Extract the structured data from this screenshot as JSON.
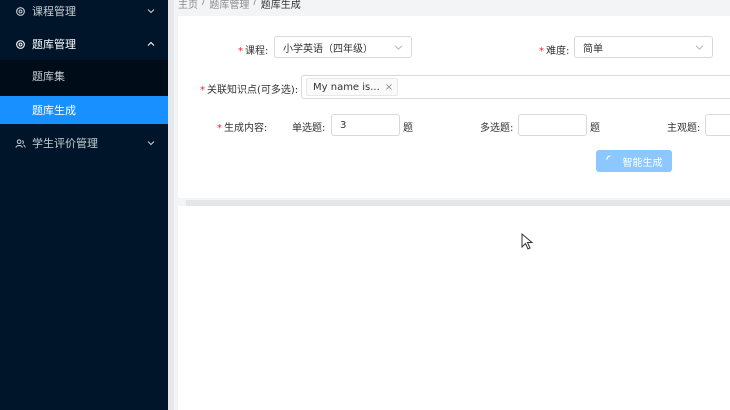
{
  "sidebar": {
    "items": [
      {
        "label": "课程管理",
        "icon": "gear-icon"
      },
      {
        "label": "题库管理",
        "icon": "gear-icon"
      },
      {
        "label": "学生评价管理",
        "icon": "people-icon"
      }
    ],
    "subitems": [
      {
        "label": "题库集"
      },
      {
        "label": "题库生成"
      }
    ]
  },
  "breadcrumb": [
    "主页",
    "题库管理",
    "题库生成"
  ],
  "form": {
    "course_label": "课程:",
    "course_value": "小学英语（四年级）",
    "difficulty_label": "难度:",
    "difficulty_value": "简单",
    "knowledge_label": "关联知识点(可多选):",
    "knowledge_tag": "My name is...",
    "content_label": "生成内容:",
    "single_label": "单选题:",
    "single_value": "3",
    "multi_label": "多选题:",
    "multi_value": "",
    "subjective_label": "主观题:",
    "subjective_value": "",
    "unit": "题",
    "generate_button": "智能生成"
  },
  "colors": {
    "sidebar_bg": "#001529",
    "active_item": "#1890ff",
    "button_loading": "#8cc8ff",
    "required": "#f5222d"
  }
}
